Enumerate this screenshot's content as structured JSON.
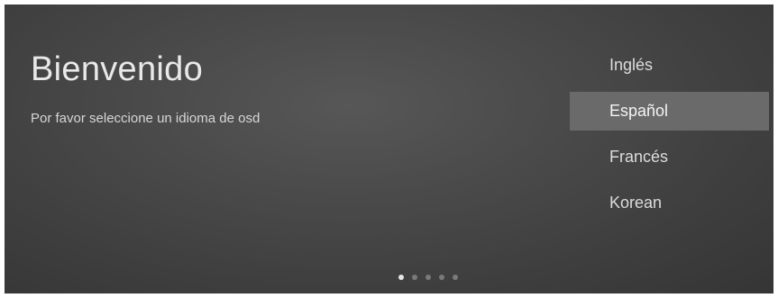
{
  "welcome": {
    "title": "Bienvenido",
    "subtitle": "Por favor seleccione un idioma de osd"
  },
  "languages": {
    "selected_index": 1,
    "items": [
      {
        "label": "Inglés"
      },
      {
        "label": "Español"
      },
      {
        "label": "Francés"
      },
      {
        "label": "Korean"
      }
    ]
  },
  "pagination": {
    "total_pages": 5,
    "current_page": 1
  },
  "colors": {
    "background": "#474747",
    "selection_highlight": "#6a6a6a",
    "text": "#e9e9e9",
    "dot_active": "#e6e6e6",
    "dot_inactive": "#7a7a7a"
  }
}
